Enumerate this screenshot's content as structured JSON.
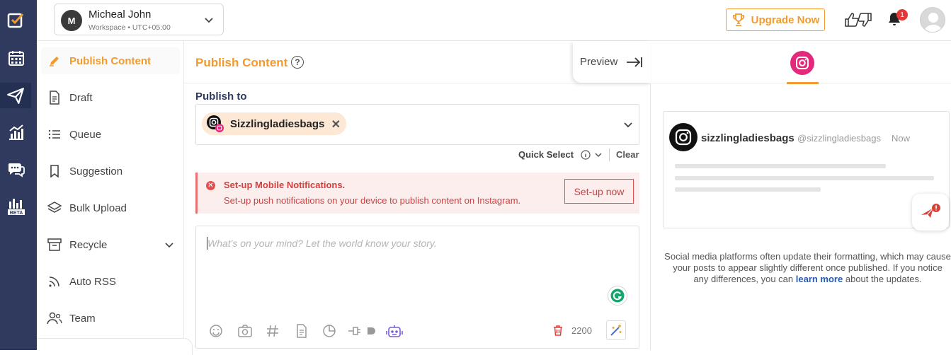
{
  "workspace": {
    "avatar_letter": "M",
    "name": "Micheal John",
    "subtitle": "Workspace • UTC+05:00"
  },
  "topbar": {
    "upgrade_label": "Upgrade Now",
    "notification_count": "1"
  },
  "sidebar": {
    "items": [
      {
        "label": "Publish Content",
        "icon": "pencil-icon",
        "active": true
      },
      {
        "label": "Draft",
        "icon": "document-icon"
      },
      {
        "label": "Queue",
        "icon": "list-icon"
      },
      {
        "label": "Suggestion",
        "icon": "bookmark-icon"
      },
      {
        "label": "Bulk Upload",
        "icon": "layers-icon"
      },
      {
        "label": "Recycle",
        "icon": "archive-icon",
        "expandable": true
      },
      {
        "label": "Auto RSS",
        "icon": "rss-icon"
      },
      {
        "label": "Team",
        "icon": "team-icon"
      }
    ]
  },
  "rail": {
    "beta_label": "BETA"
  },
  "main": {
    "title": "Publish Content",
    "help_glyph": "?",
    "preview_label": "Preview",
    "publish_to_label": "Publish to",
    "selected_account": "Sizzlingladiesbags",
    "quick_select_label": "Quick Select",
    "clear_label": "Clear",
    "alert": {
      "title": "Set-up Mobile Notifications.",
      "message": "Set-up push notifications on your device to publish content on Instagram.",
      "button_label": "Set-up now"
    },
    "composer": {
      "placeholder": "What's on your mind? Let the world know your story.",
      "char_count": "2200"
    }
  },
  "preview": {
    "account_name": "sizzlingladiesbags",
    "handle": "@sizzlingladiesbags",
    "time": "Now",
    "notice_before": "Social media platforms often update their formatting, which may cause your posts to appear slightly different once published. If you notice any differences, you can",
    "notice_link": "learn more",
    "notice_after": "about the updates."
  },
  "colors": {
    "accent": "#f29a2e",
    "rail_bg": "#2f3a5e",
    "alert_red": "#d04040",
    "instagram_pink": "#e4287c"
  }
}
